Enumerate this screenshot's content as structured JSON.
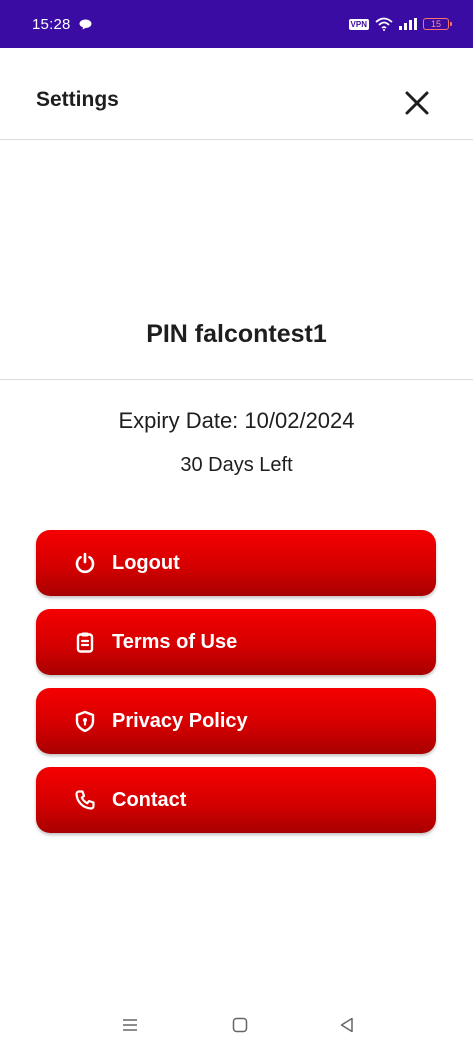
{
  "status_bar": {
    "time": "15:28",
    "vpn": "VPN",
    "battery": "15"
  },
  "header": {
    "title": "Settings",
    "close_icon": "close-icon"
  },
  "pin": {
    "title": "PIN falcontest1"
  },
  "subscription": {
    "expiry": "Expiry Date: 10/02/2024",
    "days_left": "30 Days Left"
  },
  "menu": {
    "items": [
      {
        "label": "Logout",
        "icon": "power-icon"
      },
      {
        "label": "Terms of Use",
        "icon": "clipboard-icon"
      },
      {
        "label": "Privacy Policy",
        "icon": "shield-icon"
      },
      {
        "label": "Contact",
        "icon": "phone-icon"
      }
    ]
  },
  "theme": {
    "status_bar": "#3a0ca3",
    "button_top": "#f50000",
    "button_bottom": "#a80000",
    "text": "#1e1e1e"
  }
}
